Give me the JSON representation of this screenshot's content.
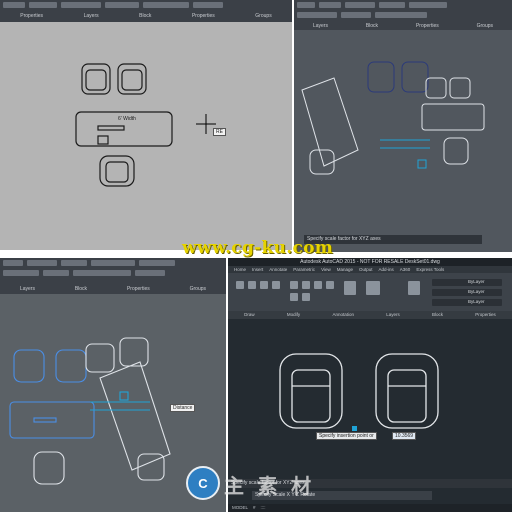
{
  "panel1": {
    "labels": [
      "Properties",
      "Layers",
      "Block",
      "Properties",
      "Groups"
    ],
    "dimension_label": "6' Width",
    "input_value": "RE"
  },
  "panel2": {
    "labels": [
      "Layers",
      "Block",
      "Properties",
      "Groups"
    ],
    "command_text": "Specify scale factor for XYZ axes"
  },
  "panel3": {
    "labels": [
      "Layers",
      "Block",
      "Properties",
      "Groups"
    ],
    "tooltip_text": "Distance"
  },
  "panel4": {
    "title": "Autodesk AutoCAD 2015 - NOT FOR RESALE   DeskSet01.dwg",
    "tabs": [
      "Home",
      "Insert",
      "Annotate",
      "Parametric",
      "View",
      "Manage",
      "Output",
      "Add-ins",
      "A360",
      "Autodesk 360",
      "BIM 360",
      "Express Tools",
      "Featured Apps"
    ],
    "ribbon_groups": [
      "Draw",
      "Modify",
      "Annotation",
      "Layers",
      "Block",
      "Properties"
    ],
    "bylayer": [
      "ByLayer",
      "ByLayer",
      "ByLayer"
    ],
    "prompt_text": "Specify insertion point or",
    "prompt_value": "10.3569",
    "command_text": "Specify scale factor for XYZ axes",
    "command_input": "Specify Scale X Y Z Rotate",
    "status": [
      "MODEL",
      "#",
      "::::"
    ]
  },
  "watermark": {
    "site": "www.cg-ku.com",
    "cn_text": "主 素 材",
    "badge": "C"
  }
}
